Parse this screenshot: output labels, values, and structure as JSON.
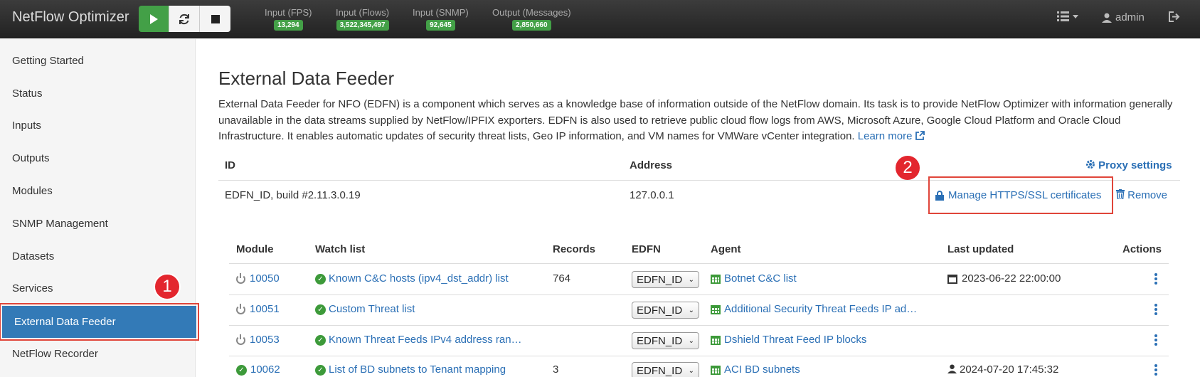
{
  "navbar": {
    "brand": "NetFlow Optimizer",
    "counters": [
      {
        "label": "Input (FPS)",
        "value": "13,294"
      },
      {
        "label": "Input (Flows)",
        "value": "3,522,345,497"
      },
      {
        "label": "Input (SNMP)",
        "value": "92,645"
      },
      {
        "label": "Output (Messages)",
        "value": "2,850,660"
      }
    ],
    "user": "admin"
  },
  "sidebar": {
    "items": [
      {
        "label": "Getting Started"
      },
      {
        "label": "Status"
      },
      {
        "label": "Inputs"
      },
      {
        "label": "Outputs"
      },
      {
        "label": "Modules"
      },
      {
        "label": "SNMP Management"
      },
      {
        "label": "Datasets"
      },
      {
        "label": "Services"
      },
      {
        "label": "External Data Feeder"
      },
      {
        "label": "NetFlow Recorder"
      }
    ]
  },
  "markers": {
    "one": "1",
    "two": "2"
  },
  "main": {
    "title": "External Data Feeder",
    "description": "External Data Feeder for NFO (EDFN) is a component which serves as a knowledge base of information outside of the NetFlow domain. Its task is to provide NetFlow Optimizer with information generally unavailable in the data streams supplied by NetFlow/IPFIX exporters. EDFN is also used to retrieve public cloud flow logs from AWS, Microsoft Azure, Google Cloud Platform and Oracle Cloud Infrastructure. It enables automatic updates of security threat lists, Geo IP information, and VM names for VMWare vCenter integration.",
    "learn_more": "Learn more",
    "feeder_table": {
      "headers": {
        "id": "ID",
        "address": "Address"
      },
      "proxy_settings": "Proxy settings",
      "row": {
        "id": "EDFN_ID, build #2.11.3.0.19",
        "address": "127.0.0.1",
        "manage_ssl": "Manage HTTPS/SSL certificates",
        "remove": "Remove"
      }
    },
    "module_table": {
      "headers": [
        "Module",
        "Watch list",
        "Records",
        "EDFN",
        "Agent",
        "Last updated",
        "Actions"
      ],
      "rows": [
        {
          "module": "10050",
          "watch": "Known C&C hosts (ipv4_dst_addr) list",
          "records": "764",
          "edfn": "EDFN_ID",
          "agent": "Botnet C&C list",
          "updated": "2023-06-22 22:00:00",
          "updated_icon": "calendar-icon",
          "module_icon": "power-icon"
        },
        {
          "module": "10051",
          "watch": "Custom Threat list",
          "records": "",
          "edfn": "EDFN_ID",
          "agent": "Additional Security Threat Feeds IP ad…",
          "updated": "",
          "updated_icon": "",
          "module_icon": "power-icon"
        },
        {
          "module": "10053",
          "watch": "Known Threat Feeds IPv4 address ran…",
          "records": "",
          "edfn": "EDFN_ID",
          "agent": "Dshield Threat Feed IP blocks",
          "updated": "",
          "updated_icon": "",
          "module_icon": "power-icon"
        },
        {
          "module": "10062",
          "watch": "List of BD subnets to Tenant mapping",
          "records": "3",
          "edfn": "EDFN_ID",
          "agent": "ACI BD subnets",
          "updated": "2024-07-20 17:45:32",
          "updated_icon": "user-icon",
          "module_icon": "check-icon"
        }
      ]
    }
  }
}
